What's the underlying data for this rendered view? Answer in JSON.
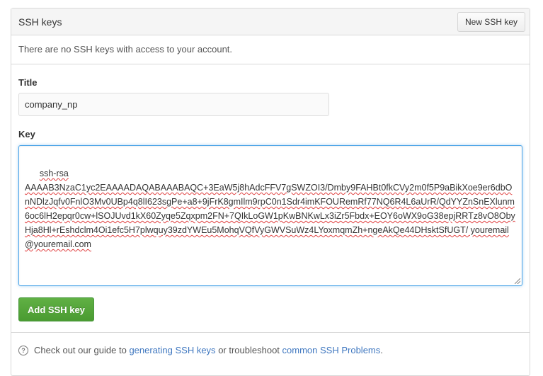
{
  "header": {
    "title": "SSH keys",
    "new_button_label": "New SSH key"
  },
  "empty_message": "There are no SSH keys with access to your account.",
  "form": {
    "title_label": "Title",
    "title_value": "company_np",
    "key_label": "Key",
    "key_value": "ssh-rsa\nAAAAB3NzaC1yc2EAAAADAQABAAABAQC+3EaW5j8hAdcFFV7gSWZOI3/Dmby9FAHBt0fkCVy2m0f5P9aBikXoe9er6dbOnNDlzJqfv0FnlO3Mv0UBp4q8lI623sgPe+a8+9jFrK8gmIlm9rpC0n1Sdr4imKFOURemRf77NQ6R4L6aUrR/QdYYZnSnEXlunm6oc6lH2epqr0cw+lSOJUvd1kX60Zyqe5Zqxpm2FN+7QIkLoGW1pKwBNKwLx3iZr5Fbdx+EOY6oWX9oG38epjRRTz8vO8ObyHja8Hl+rEshdclm4Oi1efc5H7plwquy39zdYWEu5MohqVQfVyGWVSuWz4LYoxmqmZh+ngeAkQe44DHsktSfUGT/ youremail@youremail.com",
    "add_button_label": "Add SSH key"
  },
  "footer": {
    "help_icon": "question-circle-icon",
    "prefix": "Check out our guide to",
    "guide_link": "generating SSH keys",
    "middle": "or troubleshoot",
    "problems_link": "common SSH Problems",
    "suffix": "."
  },
  "colors": {
    "accent_link": "#4078c0",
    "add_button": "#55a532",
    "focus_border": "#51a7e8"
  }
}
